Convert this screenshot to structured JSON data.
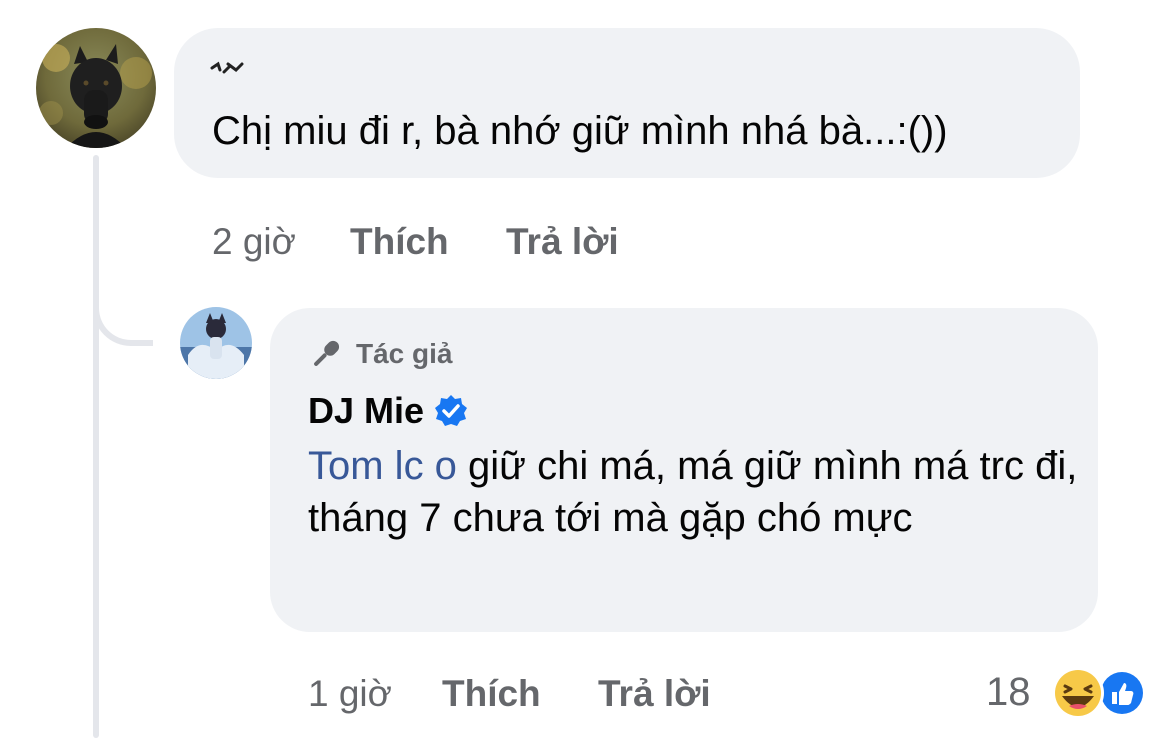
{
  "comment_1": {
    "author_label": "",
    "text": "Chị miu đi r, bà nhớ giữ mình nhá bà...:())",
    "time": "2 giờ",
    "like_label": "Thích",
    "reply_label": "Trả lời"
  },
  "reply_1": {
    "badge_label": "Tác giả",
    "author": "DJ Mie",
    "verified": true,
    "mention": "Tom lc o",
    "text": " giữ chi má, má giữ mình má trc đi, tháng 7 chưa tới mà gặp chó mực",
    "time": "1 giờ",
    "like_label": "Thích",
    "reply_label": "Trả lời",
    "reaction_count": "18",
    "reactions": [
      "haha-icon",
      "like-icon"
    ]
  },
  "colors": {
    "bubble_bg": "#f0f2f5",
    "meta_text": "#65676b",
    "mention": "#385898",
    "verified_blue": "#1877f2"
  }
}
